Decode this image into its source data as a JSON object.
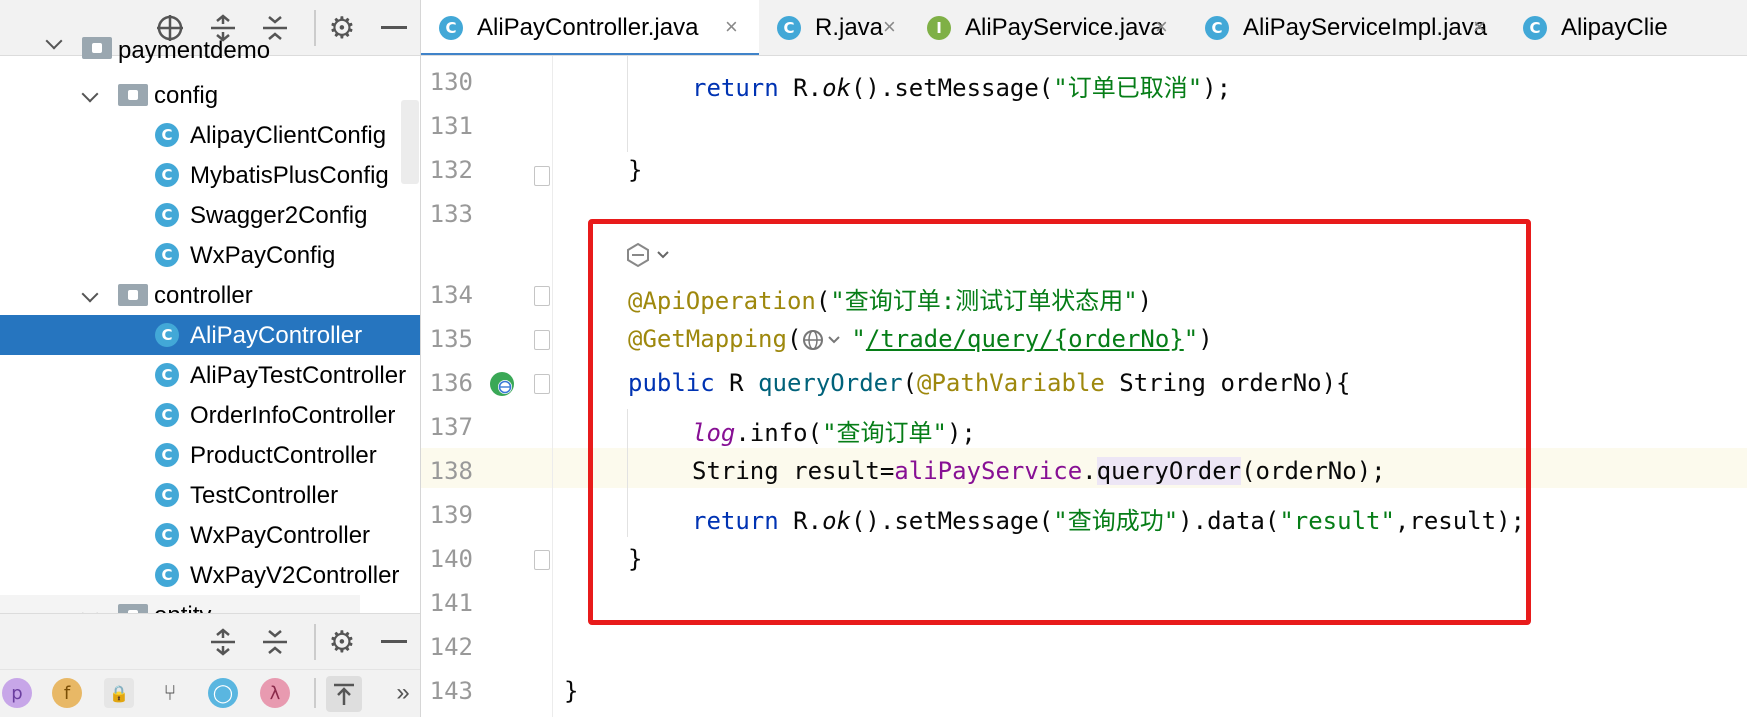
{
  "project_panel": {
    "tree": [
      {
        "label": "paymentdemo",
        "kind": "folder"
      },
      {
        "label": "config",
        "kind": "folder"
      },
      {
        "label": "AlipayClientConfig",
        "kind": "class"
      },
      {
        "label": "MybatisPlusConfig",
        "kind": "class"
      },
      {
        "label": "Swagger2Config",
        "kind": "class"
      },
      {
        "label": "WxPayConfig",
        "kind": "class"
      },
      {
        "label": "controller",
        "kind": "folder"
      },
      {
        "label": "AliPayController",
        "kind": "class",
        "selected": true
      },
      {
        "label": "AliPayTestController",
        "kind": "class"
      },
      {
        "label": "OrderInfoController",
        "kind": "class"
      },
      {
        "label": "ProductController",
        "kind": "class"
      },
      {
        "label": "TestController",
        "kind": "class"
      },
      {
        "label": "WxPayController",
        "kind": "class"
      },
      {
        "label": "WxPayV2Controller",
        "kind": "class"
      },
      {
        "label": "entity",
        "kind": "folder"
      }
    ],
    "class_icon_letter": "C",
    "bottom_icons": [
      {
        "glyph": "p",
        "color": "#c7a6e8"
      },
      {
        "glyph": "f",
        "color": "#e8b866"
      },
      {
        "glyph": "🔒",
        "color": "#e08a5a"
      },
      {
        "glyph": "⑂",
        "color": "#555555"
      },
      {
        "glyph": "◯",
        "color": "#5ab6e0"
      },
      {
        "glyph": "λ",
        "color": "#e89ab0"
      }
    ],
    "more_label": "»"
  },
  "tabs": [
    {
      "label": "AliPayController.java",
      "icon": "C",
      "active": true
    },
    {
      "label": "R.java",
      "icon": "C"
    },
    {
      "label": "AliPayService.java",
      "icon": "I"
    },
    {
      "label": "AliPayServiceImpl.java",
      "icon": "C"
    },
    {
      "label": "AlipayClie",
      "icon": "C"
    }
  ],
  "tab_close": "×",
  "editor": {
    "line_numbers": [
      "130",
      "131",
      "132",
      "133",
      "134",
      "135",
      "136",
      "137",
      "138",
      "139",
      "140",
      "141",
      "142",
      "143"
    ],
    "lines": {
      "l130": {
        "kw": "return",
        "a": " R.",
        "b": "ok",
        "c": "().setMessage(",
        "s": "\"订单已取消\"",
        "d": ");"
      },
      "l132": "}",
      "l134": {
        "an": "@ApiOperation",
        "p1": "(",
        "s": "\"查询订单:测试订单状态用\"",
        "p2": ")"
      },
      "l135": {
        "an": "@GetMapping",
        "p1": "(",
        "q1": "\"",
        "s": "/trade/query/{orderNo}",
        "q2": "\"",
        "p2": ")"
      },
      "l136": {
        "kw": "public",
        "a": " R ",
        "m": "queryOrder",
        "b": "(",
        "an": "@PathVariable",
        "c": " String orderNo){"
      },
      "l137": {
        "f": "log",
        "a": ".info(",
        "s": "\"查询订单\"",
        "b": ");"
      },
      "l138": {
        "a": "String result=",
        "f": "aliPayService",
        "b": ".",
        "m": "queryOrder",
        "c": "(orderNo);"
      },
      "l139": {
        "kw": "return",
        "a": " R.",
        "i": "ok",
        "b": "().setMessage(",
        "s1": "\"查询成功\"",
        "c": ").data(",
        "s2": "\"result\"",
        "d": ",result);"
      },
      "l140": "}",
      "l143": "}"
    }
  }
}
